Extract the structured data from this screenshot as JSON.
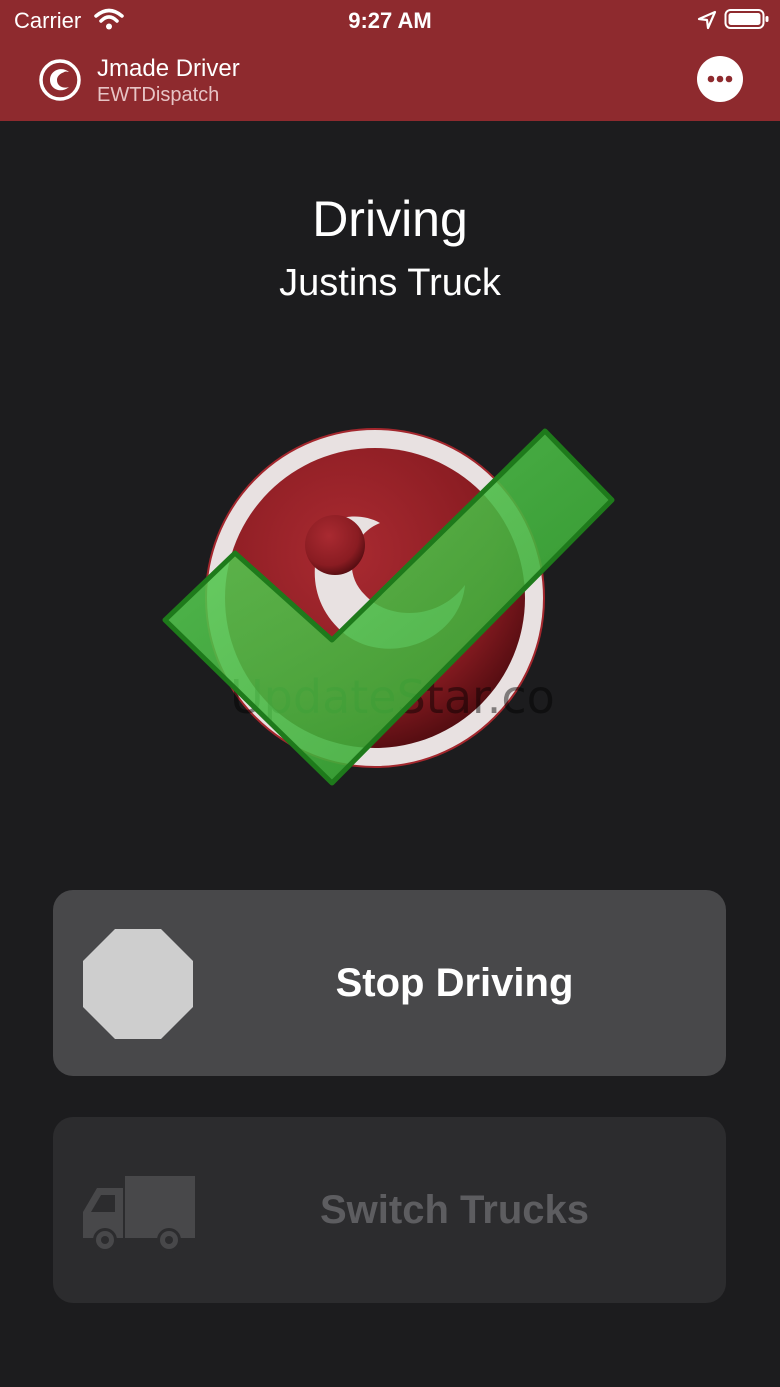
{
  "status_bar": {
    "carrier": "Carrier",
    "time": "9:27 AM"
  },
  "header": {
    "title": "Jmade Driver",
    "subtitle": "EWTDispatch",
    "background_color": "#8e2a2e",
    "more_icon": "ellipsis-circle-icon"
  },
  "main": {
    "status": "Driving",
    "truck": "Justins Truck",
    "graphic": {
      "logo_icon": "jmade-logo-icon",
      "overlay_icon": "green-checkmark-icon",
      "watermark": "UpdateStar.co"
    }
  },
  "actions": {
    "stop": {
      "label": "Stop Driving",
      "icon": "stop-octagon-icon",
      "enabled": true
    },
    "switch": {
      "label": "Switch Trucks",
      "icon": "truck-icon",
      "enabled": false
    }
  },
  "colors": {
    "accent": "#8e2a2e",
    "background": "#1c1c1e",
    "check_green": "#3db135"
  }
}
